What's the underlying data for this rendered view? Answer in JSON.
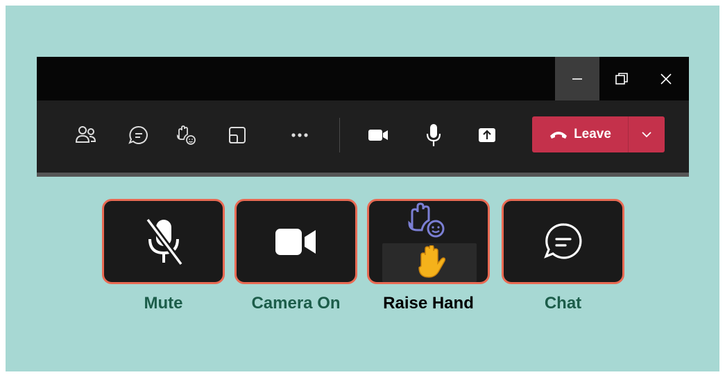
{
  "window_controls": {
    "minimize_icon": "minimize-icon",
    "maximize_icon": "restore-window-icon",
    "close_icon": "close-icon"
  },
  "toolbar": {
    "items": [
      {
        "name": "people",
        "icon": "people-icon"
      },
      {
        "name": "chat",
        "icon": "chat-icon"
      },
      {
        "name": "react",
        "icon": "raise-hand-reaction-icon"
      },
      {
        "name": "rooms",
        "icon": "view-icon"
      },
      {
        "name": "more",
        "icon": "more-options-icon"
      },
      {
        "name": "camera",
        "icon": "camera-icon"
      },
      {
        "name": "mic",
        "icon": "microphone-icon"
      },
      {
        "name": "share",
        "icon": "share-screen-icon"
      }
    ],
    "leave_label": "Leave",
    "leave_color": "#c4314b"
  },
  "cards": [
    {
      "label": "Mute",
      "icon": "mic-off-icon"
    },
    {
      "label": "Camera On",
      "icon": "video-camera-icon"
    },
    {
      "label": "Raise Hand",
      "icon": "raised-hand-icon"
    },
    {
      "label": "Chat",
      "icon": "chat-bubble-icon"
    }
  ],
  "colors": {
    "background": "#a7d8d3",
    "card_border": "#e86a53",
    "label_green": "#1c5d4a"
  }
}
